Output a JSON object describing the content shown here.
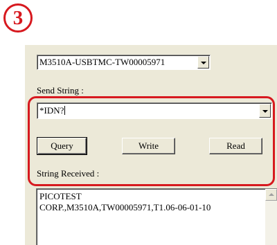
{
  "step_badge": "3",
  "instrument": {
    "selected": "M3510A-USBTMC-TW00005971"
  },
  "send": {
    "label": "Send String :",
    "value": "*IDN?"
  },
  "buttons": {
    "query": "Query",
    "write": "Write",
    "read": "Read"
  },
  "received": {
    "label": "String Received :",
    "text": "PICOTEST\nCORP.,M3510A,TW00005971,T1.06-06-01-10"
  },
  "colors": {
    "annotation": "#d7191f",
    "panel": "#ece9d8"
  }
}
